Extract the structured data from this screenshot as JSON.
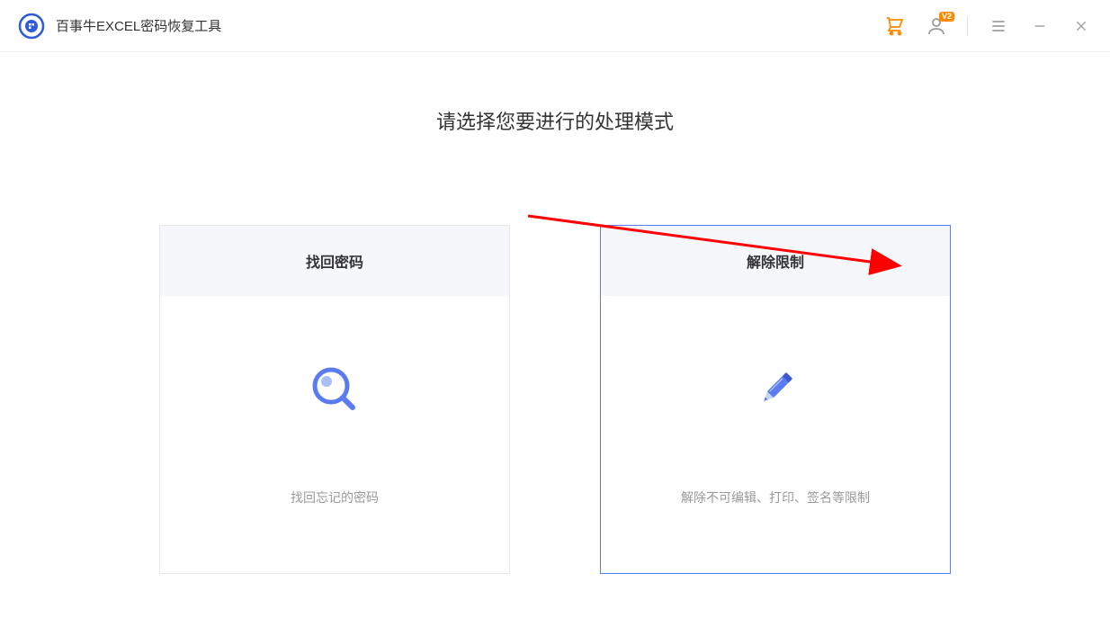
{
  "header": {
    "app_title": "百事牛EXCEL密码恢复工具",
    "user_badge": "V2"
  },
  "main": {
    "heading": "请选择您要进行的处理模式",
    "cards": [
      {
        "title": "找回密码",
        "desc": "找回忘记的密码",
        "icon": "search-magnify",
        "selected": false
      },
      {
        "title": "解除限制",
        "desc": "解除不可编辑、打印、签名等限制",
        "icon": "pencil-edit",
        "selected": true
      }
    ]
  },
  "colors": {
    "accent": "#5b7cf0",
    "cart": "#ff8a00",
    "icon_gray": "#9a9a9a"
  }
}
